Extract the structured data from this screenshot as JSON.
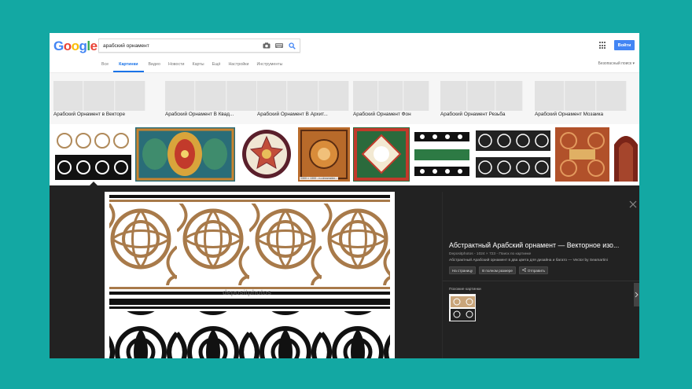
{
  "logo": {
    "letters": [
      "G",
      "o",
      "o",
      "g",
      "l",
      "e"
    ]
  },
  "search": {
    "query": "арабский орнамент"
  },
  "header": {
    "signin_label": "Войти"
  },
  "tabs": [
    {
      "label": "Все"
    },
    {
      "label": "Картинки",
      "active": true
    },
    {
      "label": "Видео"
    },
    {
      "label": "Новости"
    },
    {
      "label": "Карты"
    },
    {
      "label": "Ещё"
    },
    {
      "label": "Настройки"
    },
    {
      "label": "Инструменты"
    }
  ],
  "safe_search": "Безопасный поиск ▾",
  "chips": [
    {
      "label": "Арабский Орнамент в Векторе"
    },
    {
      "label": "Арабский Орнамент В Квад..."
    },
    {
      "label": "Арабский Орнамент В Архит..."
    },
    {
      "label": "Арабский Орнамент Фон"
    },
    {
      "label": "Арабский Орнамент Резьба"
    },
    {
      "label": "Арабский Орнамент Мозаика"
    }
  ],
  "thumbnail_caption": "1300 × 1300 - ru.dreamstim...",
  "watermark": "depositphotos",
  "viewer": {
    "title": "Абстрактный Арабский орнамент — Векторное изо...",
    "meta": "Depositphotos - 1024 × 723 - Поиск по картинке",
    "description": "Абстрактный Арабский орнамент в два цвета для дизайна и багато — Vector by Seamartini",
    "actions": [
      {
        "label": "На страницу",
        "icon": "none"
      },
      {
        "label": "В полном размере",
        "icon": "none"
      },
      {
        "label": "Отправить",
        "icon": "share-icon"
      }
    ],
    "similar_label": "Похожие картинки"
  },
  "colors": {
    "background": "#13a8a3",
    "accent": "#4285f4",
    "viewer_bg": "#222222",
    "ornament_brown": "#a87a4a"
  }
}
